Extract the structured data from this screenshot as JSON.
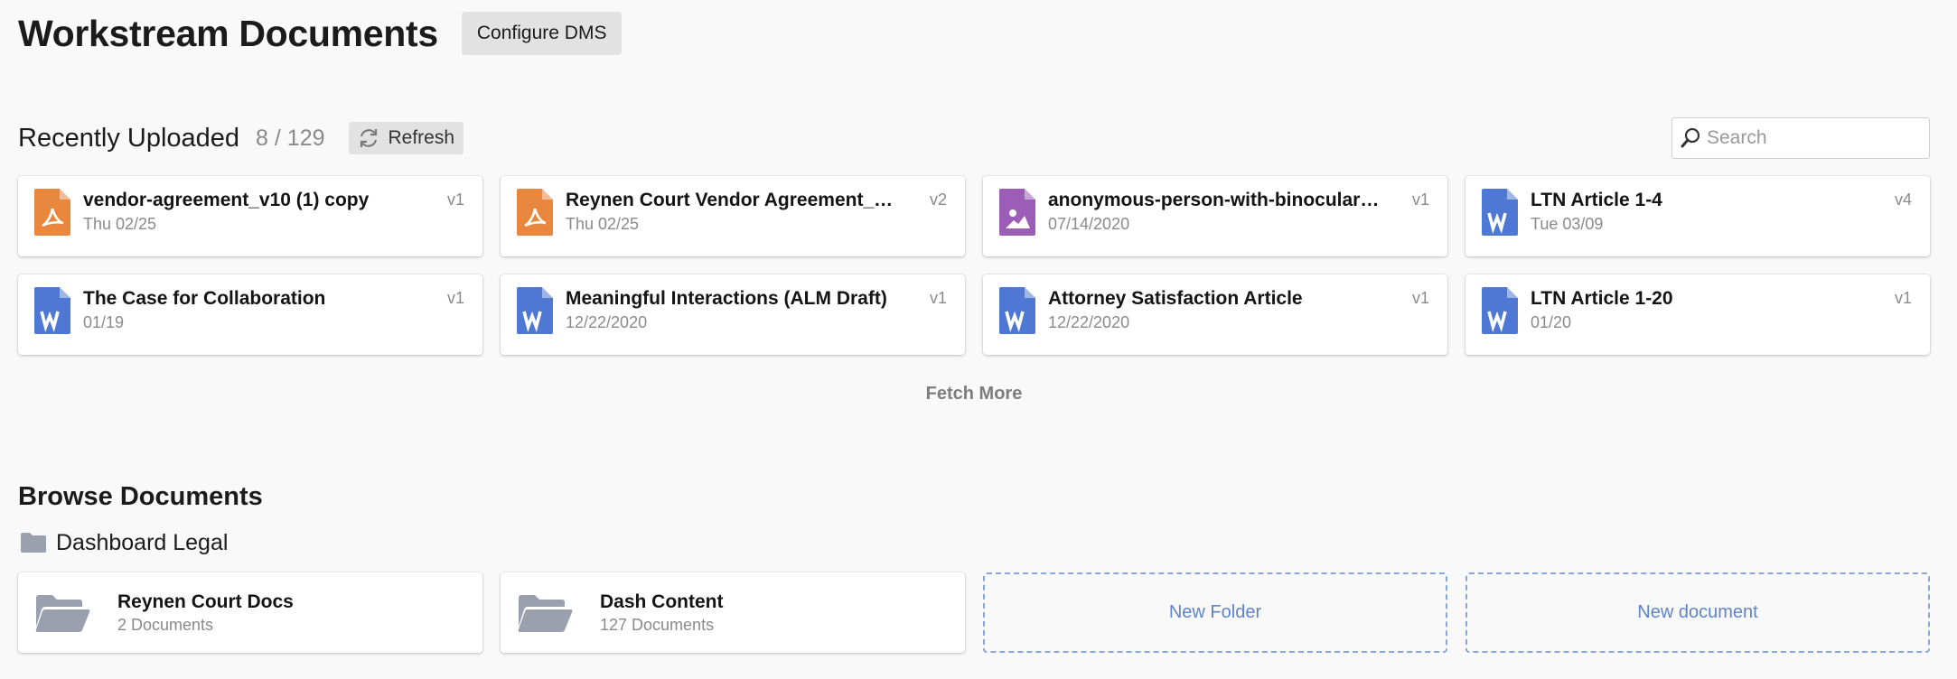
{
  "header": {
    "title": "Workstream Documents",
    "configure_label": "Configure DMS"
  },
  "recent": {
    "title": "Recently Uploaded",
    "count": "8 / 129",
    "refresh_label": "Refresh",
    "search_placeholder": "Search",
    "documents": [
      {
        "name": "vendor-agreement_v10 (1) copy",
        "date": "Thu 02/25",
        "version": "v1",
        "type": "pdf"
      },
      {
        "name": "Reynen Court Vendor Agreement_Master Vendor Agreement",
        "date": "Thu 02/25",
        "version": "v2",
        "type": "pdf"
      },
      {
        "name": "anonymous-person-with-binoculars-looking-away",
        "date": "07/14/2020",
        "version": "v1",
        "type": "image"
      },
      {
        "name": "LTN Article 1-4",
        "date": "Tue 03/09",
        "version": "v4",
        "type": "word"
      },
      {
        "name": "The Case for Collaboration",
        "date": "01/19",
        "version": "v1",
        "type": "word"
      },
      {
        "name": "Meaningful Interactions (ALM Draft)",
        "date": "12/22/2020",
        "version": "v1",
        "type": "word"
      },
      {
        "name": "Attorney Satisfaction Article",
        "date": "12/22/2020",
        "version": "v1",
        "type": "word"
      },
      {
        "name": "LTN Article 1-20",
        "date": "01/20",
        "version": "v1",
        "type": "word"
      }
    ],
    "fetch_more_label": "Fetch More"
  },
  "browse": {
    "title": "Browse Documents",
    "breadcrumb": "Dashboard Legal",
    "folders": [
      {
        "name": "Reynen Court Docs",
        "count": "2 Documents"
      },
      {
        "name": "Dash Content",
        "count": "127 Documents"
      }
    ],
    "new_folder_label": "New Folder",
    "new_document_label": "New document"
  },
  "colors": {
    "pdf": "#e8873d",
    "image": "#9b5db5",
    "word": "#4f78d4",
    "folder": "#9aa0ad",
    "dashed_accent": "#5f83c9"
  },
  "icons": {
    "pdf": "pdf-file-icon",
    "image": "image-file-icon",
    "word": "word-file-icon",
    "folder": "folder-open-icon",
    "refresh": "refresh-icon",
    "search": "search-icon"
  }
}
